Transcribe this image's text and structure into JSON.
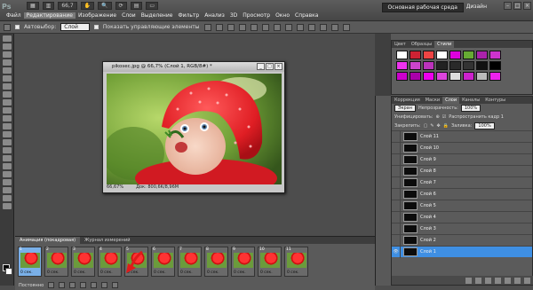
{
  "app": {
    "logo": "Ps",
    "menu": [
      "Файл",
      "Редактирование",
      "Изображение",
      "Слои",
      "Выделение",
      "Фильтр",
      "Анализ",
      "3D",
      "Просмотр",
      "Окно",
      "Справка"
    ],
    "active_menu": "Редактирование",
    "zoom": "66,7",
    "workspace": "Основная рабочая среда",
    "design": "Дизайн"
  },
  "options": {
    "autoselect_label": "Автовыбор:",
    "autoselect_value": "Слой",
    "show_controls_label": "Показать управляющие элементы"
  },
  "document": {
    "title": "pikosec.jpg @ 66,7% (Слой 1, RGB/8#) *",
    "zoom": "66,67%",
    "status": "Док: 800,6K/8,96M"
  },
  "styles_panel": {
    "tabs": [
      "Цвет",
      "Образцы",
      "Стили"
    ],
    "active_tab": "Стили"
  },
  "layers_panel": {
    "tabs": [
      "Коррекция",
      "Маски",
      "Слои",
      "Каналы",
      "Контуры"
    ],
    "active_tab": "Слои",
    "blend_mode": "Экран",
    "opacity_label": "Непрозрачность:",
    "opacity_value": "100%",
    "unify_label": "Унифицировать:",
    "propagate_label": "Распространить кадр 1",
    "lock_label": "Закрепить:",
    "fill_label": "Заливка:",
    "fill_value": "100%",
    "layers": [
      "Слой 11",
      "Слой 10",
      "Слой 9",
      "Слой 8",
      "Слой 7",
      "Слой 6",
      "Слой 5",
      "Слой 4",
      "Слой 3",
      "Слой 2",
      "Слой 1"
    ],
    "selected_layer": "Слой 1"
  },
  "animation_panel": {
    "tabs": [
      "Анимация (покадровая)",
      "Журнал измерений"
    ],
    "active_tab": "Анимация (покадровая)",
    "frames": [
      {
        "num": "1",
        "dur": "0 сек."
      },
      {
        "num": "2",
        "dur": "0 сек."
      },
      {
        "num": "3",
        "dur": "0 сек."
      },
      {
        "num": "4",
        "dur": "0 сек."
      },
      {
        "num": "5",
        "dur": "0 сек."
      },
      {
        "num": "6",
        "dur": "0 сек."
      },
      {
        "num": "7",
        "dur": "0 сек."
      },
      {
        "num": "8",
        "dur": "0 сек."
      },
      {
        "num": "9",
        "dur": "0 сек."
      },
      {
        "num": "10",
        "dur": "0 сек."
      },
      {
        "num": "11",
        "dur": "0 сек."
      }
    ],
    "loop": "Постоянно"
  },
  "colors": {
    "selection": "#3f8fe3",
    "arrow": "#e01a1a"
  }
}
